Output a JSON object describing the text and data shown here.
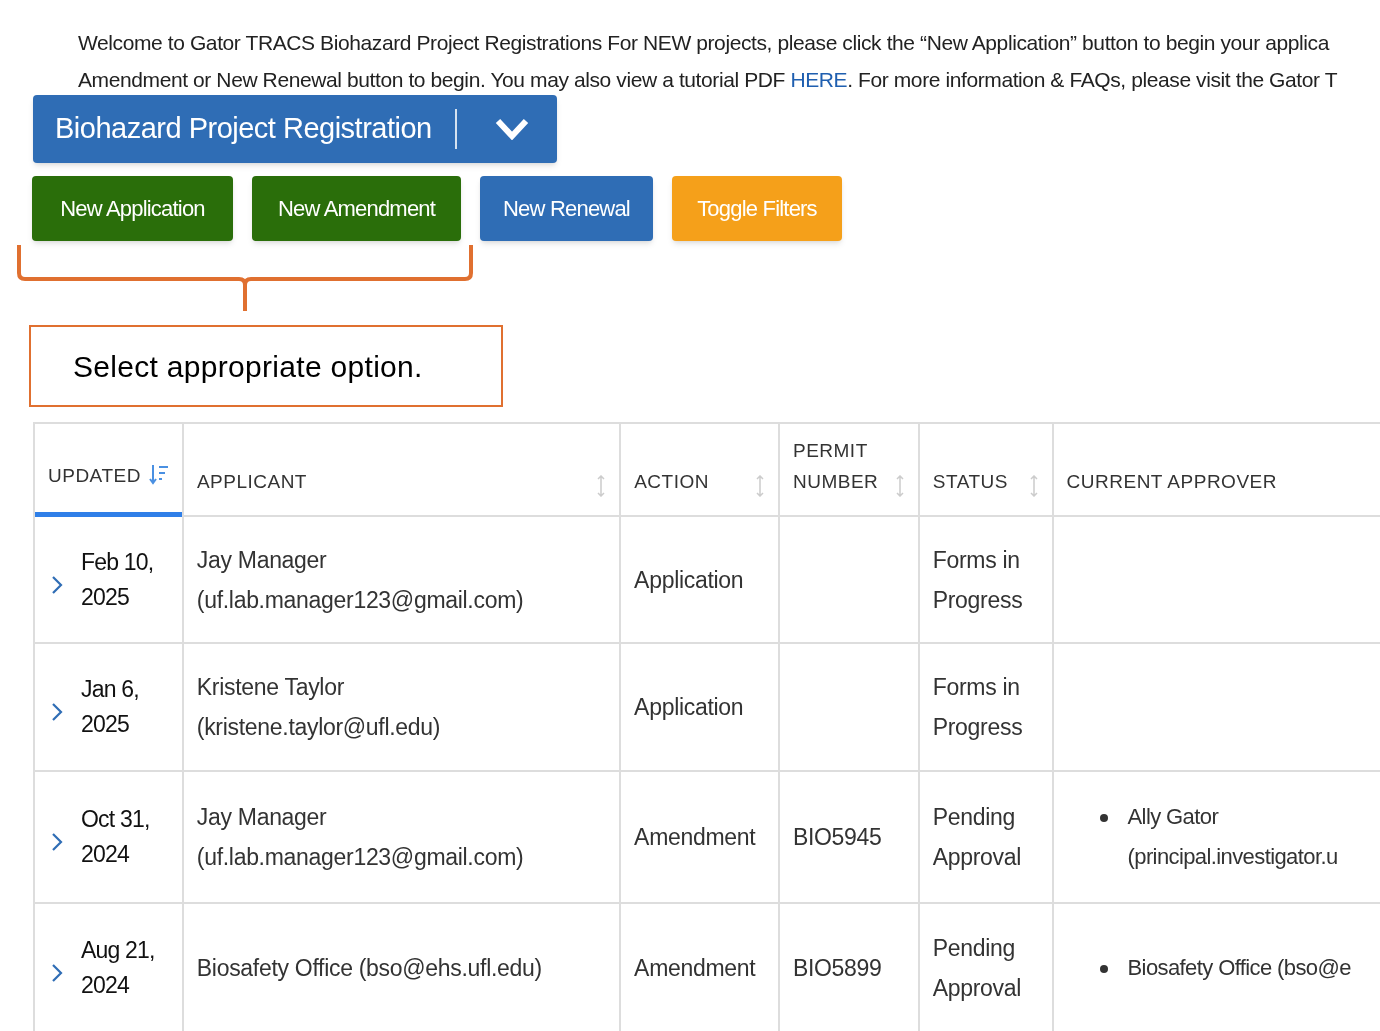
{
  "intro": {
    "line_1": "Welcome to Gator TRACS Biohazard Project Registrations For NEW projects, please click the “New Application” button to begin your applica",
    "line_2_before": "Amendment or New Renewal button to begin. You may also view a tutorial PDF ",
    "link": "HERE",
    "line_2_after": ". For more information & FAQs, please visit the Gator T"
  },
  "dropdown": {
    "label": "Biohazard Project Registration"
  },
  "buttons": [
    {
      "label": "New Application",
      "kind": "green"
    },
    {
      "label": "New Amendment",
      "kind": "green"
    },
    {
      "label": "New Renewal",
      "kind": "blue"
    },
    {
      "label": "Toggle Filters",
      "kind": "orange"
    }
  ],
  "callout": {
    "text": "Select appropriate option."
  },
  "table": {
    "columns": [
      {
        "label": "UPDATED",
        "sorted": true
      },
      {
        "label": "APPLICANT",
        "sorted": false
      },
      {
        "label": "ACTION",
        "sorted": false
      },
      {
        "label": "PERMIT NUMBER",
        "sorted": false
      },
      {
        "label": "STATUS",
        "sorted": false
      },
      {
        "label": "CURRENT APPROVER"
      }
    ],
    "rows": [
      {
        "updated": [
          "Feb 10,",
          "2025"
        ],
        "applicant": [
          "Jay Manager",
          "(uf.lab.manager123@gmail.com)"
        ],
        "action": "Application",
        "status": "Forms in Progress"
      },
      {
        "updated": [
          "Jan 6,",
          "2025"
        ],
        "applicant": [
          "Kristene Taylor",
          "(kristene.taylor@ufl.edu)"
        ],
        "action": "Application",
        "status": "Forms in Progress"
      },
      {
        "updated": [
          "Oct 31,",
          "2024"
        ],
        "applicant": [
          "Jay Manager",
          "(uf.lab.manager123@gmail.com)"
        ],
        "action": "Amendment",
        "permit": "BIO5945",
        "status": "Pending Approval",
        "approvers": [
          [
            "Ally Gator",
            "(principal.investigator.u"
          ]
        ]
      },
      {
        "updated": [
          "Aug 21,",
          "2024"
        ],
        "applicant": [
          "Biosafety Office (bso@ehs.ufl.edu)"
        ],
        "action": "Amendment",
        "permit": "BIO5899",
        "status": "Pending Approval",
        "approvers": [
          [
            "Biosafety Office (bso@e"
          ]
        ]
      }
    ]
  }
}
